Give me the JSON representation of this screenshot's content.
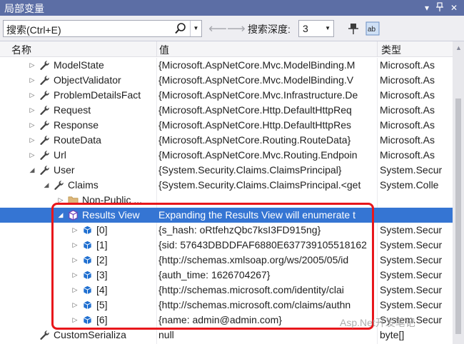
{
  "window": {
    "title": "局部变量"
  },
  "toolbar": {
    "search_placeholder": "搜索(Ctrl+E)",
    "depth_label": "搜索深度:",
    "depth_value": "3",
    "back_icon": "arrow-left-icon",
    "forward_icon": "arrow-right-icon"
  },
  "columns": {
    "name": "名称",
    "value": "值",
    "type": "类型"
  },
  "rows": [
    {
      "name": "ModelState",
      "value": "{Microsoft.AspNetCore.Mvc.ModelBinding.M",
      "type": "Microsoft.As",
      "icon": "wrench-icon",
      "indent": 1,
      "expander": "collapsed"
    },
    {
      "name": "ObjectValidator",
      "value": "{Microsoft.AspNetCore.Mvc.ModelBinding.V",
      "type": "Microsoft.As",
      "icon": "wrench-icon",
      "indent": 1,
      "expander": "collapsed"
    },
    {
      "name": "ProblemDetailsFact",
      "value": "{Microsoft.AspNetCore.Mvc.Infrastructure.De",
      "type": "Microsoft.As",
      "icon": "wrench-icon",
      "indent": 1,
      "expander": "collapsed"
    },
    {
      "name": "Request",
      "value": "{Microsoft.AspNetCore.Http.DefaultHttpReq",
      "type": "Microsoft.As",
      "icon": "wrench-icon",
      "indent": 1,
      "expander": "collapsed"
    },
    {
      "name": "Response",
      "value": "{Microsoft.AspNetCore.Http.DefaultHttpRes",
      "type": "Microsoft.As",
      "icon": "wrench-icon",
      "indent": 1,
      "expander": "collapsed"
    },
    {
      "name": "RouteData",
      "value": "{Microsoft.AspNetCore.Routing.RouteData}",
      "type": "Microsoft.As",
      "icon": "wrench-icon",
      "indent": 1,
      "expander": "collapsed"
    },
    {
      "name": "Url",
      "value": "{Microsoft.AspNetCore.Mvc.Routing.Endpoin",
      "type": "Microsoft.As",
      "icon": "wrench-icon",
      "indent": 1,
      "expander": "collapsed"
    },
    {
      "name": "User",
      "value": "{System.Security.Claims.ClaimsPrincipal}",
      "type": "System.Secur",
      "icon": "wrench-icon",
      "indent": 1,
      "expander": "expanded"
    },
    {
      "name": "Claims",
      "value": "{System.Security.Claims.ClaimsPrincipal.<get",
      "type": "System.Colle",
      "icon": "wrench-icon",
      "indent": 2,
      "expander": "expanded"
    },
    {
      "name": "Non-Public ...",
      "value": "",
      "type": "",
      "icon": "folder-icon",
      "indent": 3,
      "expander": "collapsed"
    },
    {
      "name": "Results View",
      "value": "Expanding the Results View will enumerate t",
      "type": "",
      "icon": "cube-icon",
      "indent": 3,
      "expander": "expanded",
      "selected": true
    },
    {
      "name": "[0]",
      "value": "{s_hash: oRtfehzQbc7ksI3FD915ng}",
      "type": "System.Secur",
      "icon": "blue-cube-icon",
      "indent": 4,
      "expander": "collapsed"
    },
    {
      "name": "[1]",
      "value": "{sid: 57643DBDDFAF6880E637739105518162",
      "type": "System.Secur",
      "icon": "blue-cube-icon",
      "indent": 4,
      "expander": "collapsed"
    },
    {
      "name": "[2]",
      "value": "{http://schemas.xmlsoap.org/ws/2005/05/id",
      "type": "System.Secur",
      "icon": "blue-cube-icon",
      "indent": 4,
      "expander": "collapsed"
    },
    {
      "name": "[3]",
      "value": "{auth_time: 1626704267}",
      "type": "System.Secur",
      "icon": "blue-cube-icon",
      "indent": 4,
      "expander": "collapsed"
    },
    {
      "name": "[4]",
      "value": "{http://schemas.microsoft.com/identity/clai",
      "type": "System.Secur",
      "icon": "blue-cube-icon",
      "indent": 4,
      "expander": "collapsed"
    },
    {
      "name": "[5]",
      "value": "{http://schemas.microsoft.com/claims/authn",
      "type": "System.Secur",
      "icon": "blue-cube-icon",
      "indent": 4,
      "expander": "collapsed"
    },
    {
      "name": "[6]",
      "value": "{name: admin@admin.com}",
      "type": "System.Secur",
      "icon": "blue-cube-icon",
      "indent": 4,
      "expander": "collapsed"
    },
    {
      "name": "CustomSerializa",
      "value": "null",
      "type": "byte[]",
      "icon": "wrench-icon",
      "indent": 1,
      "expander": "none"
    }
  ],
  "watermark": "Asp.Net开发笔记",
  "colors": {
    "title_bar": "#5c6ea5",
    "selection": "#3575d3",
    "highlight_box": "#e8161b"
  }
}
